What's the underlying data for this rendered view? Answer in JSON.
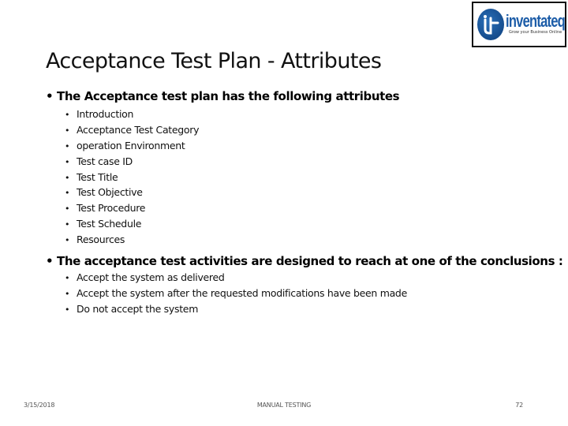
{
  "logo": {
    "name": "inventateq",
    "tagline": "Grow your Business Online",
    "brand_color": "#1d5da8"
  },
  "slide": {
    "title": "Acceptance Test Plan - Attributes",
    "sections": [
      {
        "heading": "The Acceptance test plan has the following attributes",
        "items": [
          "Introduction",
          "Acceptance Test Category",
          "operation Environment",
          "Test case ID",
          "Test Title",
          "Test Objective",
          "Test Procedure",
          "Test Schedule",
          "Resources"
        ]
      },
      {
        "heading": "The acceptance test activities are designed to reach at one of the conclusions :",
        "items": [
          "Accept the system as delivered",
          "Accept the system after the requested modifications have been made",
          "Do not accept the system"
        ]
      }
    ]
  },
  "footer": {
    "date": "3/15/2018",
    "center": "MANUAL TESTING",
    "page": "72"
  }
}
